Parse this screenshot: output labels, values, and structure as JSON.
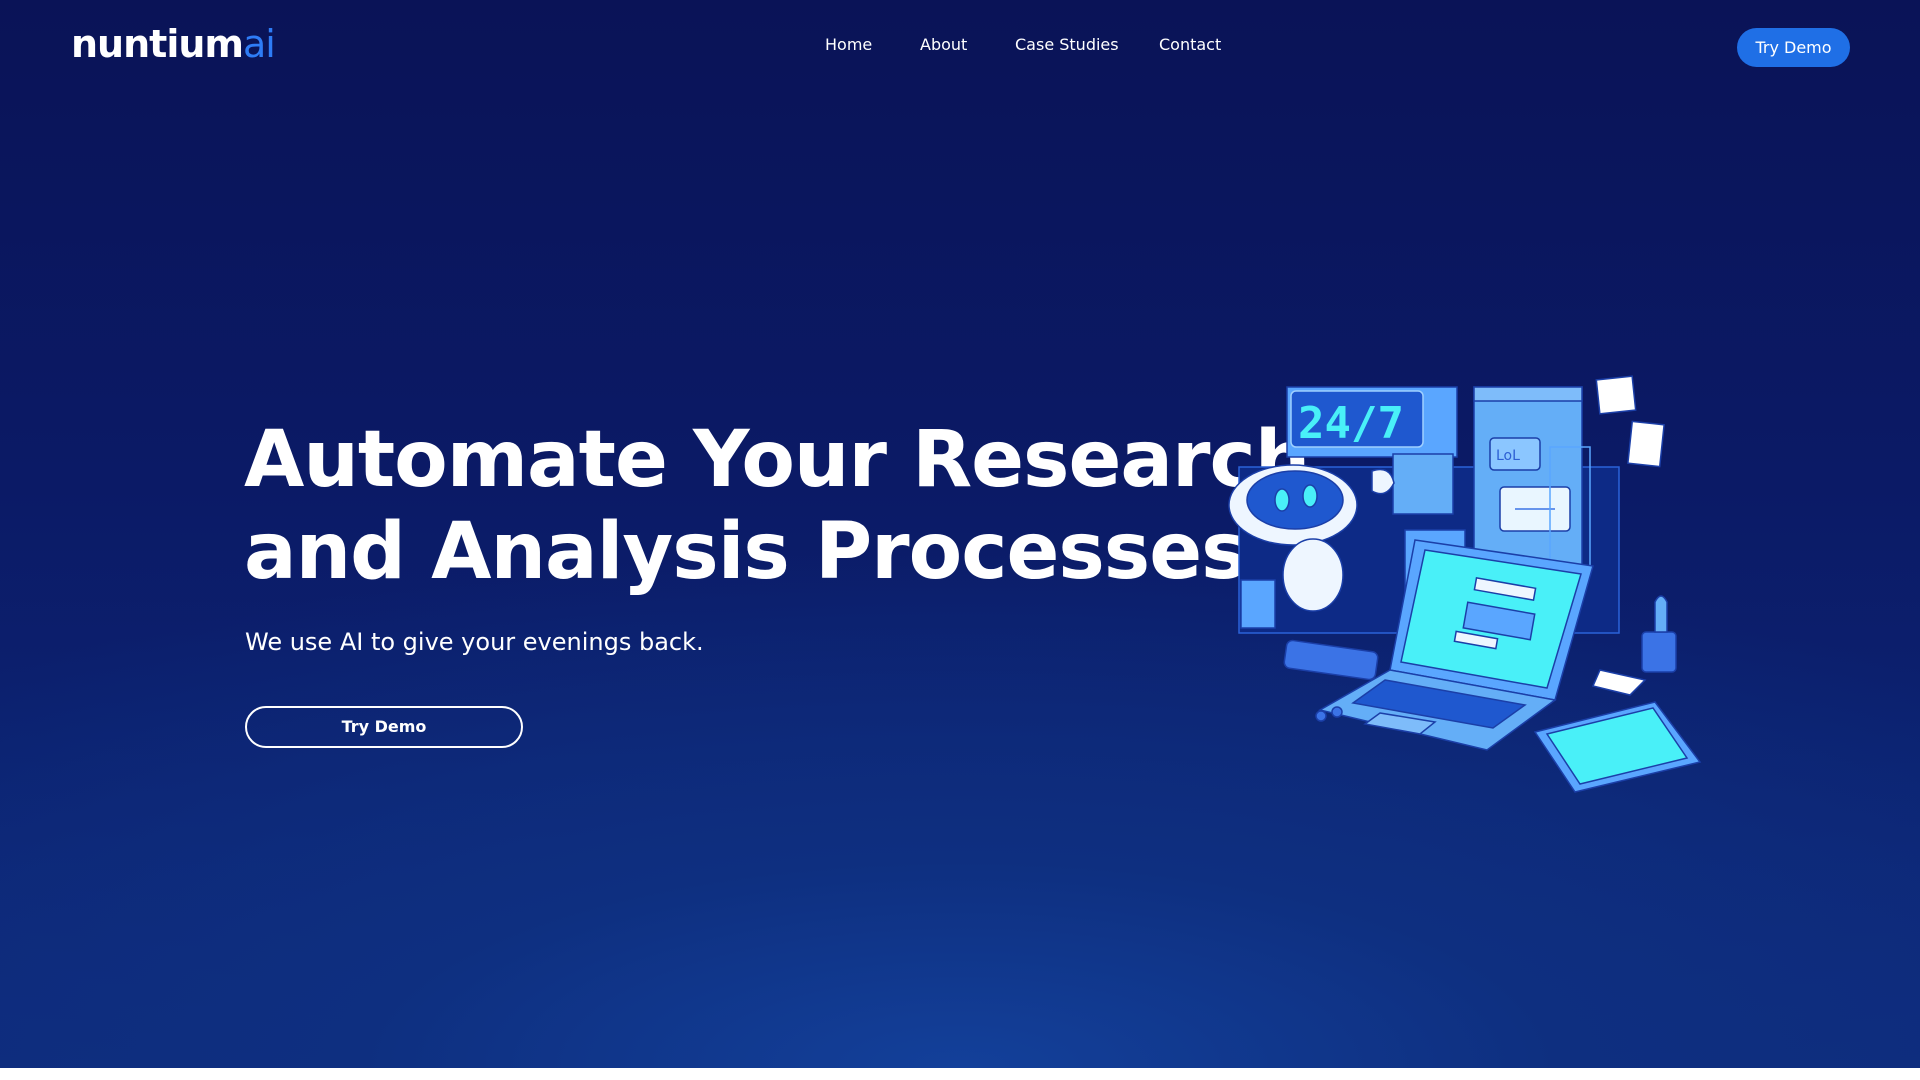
{
  "brand": {
    "name": "nuntium",
    "suffix": "ai",
    "accent_color": "#2e7cf6"
  },
  "nav": {
    "items": [
      {
        "label": "Home"
      },
      {
        "label": "About"
      },
      {
        "label": "Case Studies"
      },
      {
        "label": "Contact"
      }
    ],
    "cta_label": "Try Demo"
  },
  "hero": {
    "title_line1": "Automate Your Research",
    "title_line2": "and Analysis Processes",
    "subtitle": "We use AI to give your evenings back.",
    "cta_label": "Try Demo",
    "illustration": {
      "clock_text": "24/7",
      "chat_text": "LoL",
      "icon": "robot-laptop-illustration"
    }
  },
  "colors": {
    "background_top": "#0a1357",
    "background_bottom": "#13409a",
    "primary_button": "#1f6fe6",
    "illustration_light": "#5aa6ff",
    "illustration_cyan": "#49f0f8"
  }
}
